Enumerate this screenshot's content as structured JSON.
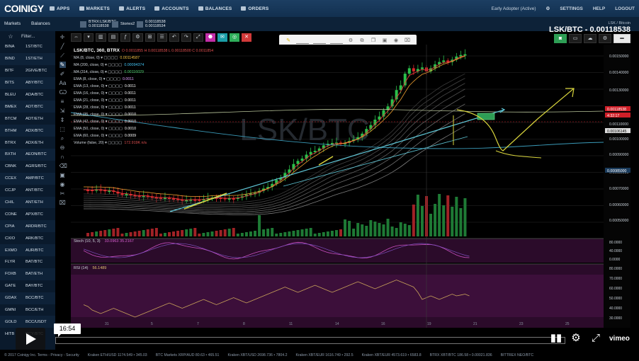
{
  "nav": {
    "logo": "COINIGY",
    "items": [
      "APPS",
      "MARKETS",
      "ALERTS",
      "ACCOUNTS",
      "BALANCES",
      "ORDERS"
    ],
    "user": "Early Adopter (Active)",
    "settings": "SETTINGS",
    "help": "HELP",
    "logout": "LOGOUT"
  },
  "subbar": {
    "markets_tab": "Markets",
    "balances_tab": "Balances",
    "ticker1": "BTRX:LSK/BTC",
    "ticker1_price": "0.00118538",
    "ticker2": "Stories2",
    "ticker3_top": "0.00118538",
    "ticker3_bottom": "0.00118534"
  },
  "pair": {
    "sub": "LSK / Bitcoin",
    "main": "LSK/BTC - 0.00118538"
  },
  "sidebar": {
    "filter_placeholder": "Filter...",
    "markets": [
      {
        "ex": "BINA",
        "pair": "1ST/BTC"
      },
      {
        "ex": "BIND",
        "pair": "1ST/ETH"
      },
      {
        "ex": "BITF",
        "pair": "2GIVE/BTC"
      },
      {
        "ex": "BITS",
        "pair": "ABY/BTC"
      },
      {
        "ex": "BLEU",
        "pair": "ADA/BTC"
      },
      {
        "ex": "BMEX",
        "pair": "ADT/BTC"
      },
      {
        "ex": "BTCM",
        "pair": "ADT/ETH"
      },
      {
        "ex": "BTHM",
        "pair": "ADX/BTC"
      },
      {
        "ex": "BTRX",
        "pair": "ADX/ETH"
      },
      {
        "ex": "BXTH",
        "pair": "AEON/BTC"
      },
      {
        "ex": "CBNK",
        "pair": "AGRS/BTC"
      },
      {
        "ex": "CCEX",
        "pair": "AMP/BTC"
      },
      {
        "ex": "CCJP",
        "pair": "ANT/BTC"
      },
      {
        "ex": "CHIL",
        "pair": "ANT/ETH"
      },
      {
        "ex": "CONE",
        "pair": "APX/BTC"
      },
      {
        "ex": "CPIA",
        "pair": "ARDR/BTC"
      },
      {
        "ex": "CXIO",
        "pair": "ARK/BTC"
      },
      {
        "ex": "EXMO",
        "pair": "AUR/BTC"
      },
      {
        "ex": "FLYR",
        "pair": "BAT/BTC"
      },
      {
        "ex": "FOXB",
        "pair": "BAT/ETH"
      },
      {
        "ex": "GATE",
        "pair": "BAY/BTC"
      },
      {
        "ex": "GDAX",
        "pair": "BCC/BTC"
      },
      {
        "ex": "GMNI",
        "pair": "BCC/ETH"
      },
      {
        "ex": "GOLD",
        "pair": "BCC/USDT"
      },
      {
        "ex": "HITB",
        "pair": "BCY/BTC"
      }
    ]
  },
  "legend": {
    "symbol": "LSK/BTC, 360, BTRX",
    "ohlc": "O 0.0011855 H 0.00118538 L 0.00118500 C 0.0011854",
    "indicators": [
      {
        "name": "MA (8, close, 0)",
        "value": "0.00114587"
      },
      {
        "name": "MA (200, close, 0)",
        "value": "0.00094374"
      },
      {
        "name": "MA (314, close, 0)",
        "value": "0.00116029"
      },
      {
        "name": "EMA (8, close, 0)",
        "value": "0.0011"
      },
      {
        "name": "EMA (13, close, 0)",
        "value": "0.0011"
      },
      {
        "name": "EMA (16, close, 0)",
        "value": "0.0011"
      },
      {
        "name": "EMA (21, close, 0)",
        "value": "0.0011"
      },
      {
        "name": "EMA (28, close, 0)",
        "value": "0.0011"
      },
      {
        "name": "EMA (35, close, 0)",
        "value": "0.0010"
      },
      {
        "name": "EMA (42, close, 0)",
        "value": "0.0010"
      },
      {
        "name": "EMA (50, close, 0)",
        "value": "0.0010"
      },
      {
        "name": "EMA (60, close, 0)",
        "value": "0.0009"
      },
      {
        "name": "Volume (false, 20)",
        "value": "172.919K n/a"
      }
    ],
    "stoch_label": "Stoch (10, 5, 3)",
    "stoch_values": "33.0963  35.2167",
    "rsi_label": "RSI (14)",
    "rsi_value": "56.1489"
  },
  "price_axis": [
    "0.00150000",
    "0.00140000",
    "0.00130000",
    "0.00120000",
    "0.00118538",
    "0.00110000",
    "0.00100000",
    "0.00090000",
    "0.00080000",
    "0.00070000",
    "0.00060000",
    "0.00050000"
  ],
  "price_badge_a": "0.00118538",
  "price_badge_b": "4:32:17",
  "price_badge_c": "0.00106145",
  "price_badge_d": "0.00085000",
  "stoch_axis": [
    "80.0000",
    "40.0000",
    "0.0000"
  ],
  "rsi_axis": [
    "80.0000",
    "70.0000",
    "60.0000",
    "50.0000",
    "40.0000",
    "30.0000"
  ],
  "watermark": "LSK/BTC",
  "date_axis": [
    "31",
    "5",
    "7",
    "8",
    "11",
    "14",
    "16",
    "19",
    "21",
    "23",
    "25"
  ],
  "video": {
    "time": "16:54",
    "progress": 0.0,
    "vimeo": "vimeo"
  },
  "footer": [
    "© 2017 Coinigy Inc.  Terms - Privacy - Security",
    "Kraken ETH/USD 1174.549 • 345.03",
    "BTC Markets XRP/AUD 80.63 • 465.51",
    "Kraken XBT/USD 2698.736 • 7804.2",
    "Kraken XBT/EUR 1616.749 • 292.5",
    "Kraken XBT/EUR 4573.619 • 6583.8",
    "BTRX XBT/BTC 186.58 • 0.00021.836",
    "BITTREX NEO/BTC"
  ],
  "colors": {
    "nav_bg": "#1c3e62",
    "up": "#2bbf4a",
    "down": "#d9262a",
    "teal": "#5ec6d6",
    "annotation": "#d8d43c",
    "stoch_bg": "#2b0b2a",
    "rsi_bg": "#2b0b2a"
  }
}
